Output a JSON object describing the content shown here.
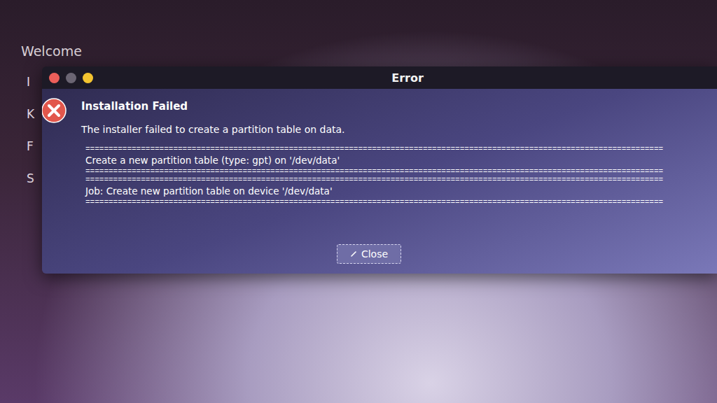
{
  "window": {
    "title": "Error"
  },
  "sidebar": {
    "title": "Welcome",
    "items": [
      "I",
      "K",
      "F",
      "S"
    ]
  },
  "dialog": {
    "heading": "Installation Failed",
    "message": "The installer failed to create a partition table on data.",
    "details": [
      {
        "kind": "separator",
        "text": "============================================================================================================================="
      },
      {
        "kind": "line",
        "text": "Create a new partition table (type: gpt) on '/dev/data'"
      },
      {
        "kind": "separator",
        "text": "============================================================================================================================="
      },
      {
        "kind": "separator",
        "text": "============================================================================================================================="
      },
      {
        "kind": "line",
        "text": "Job: Create new partition table on device '/dev/data'"
      },
      {
        "kind": "separator",
        "text": "============================================================================================================================="
      }
    ],
    "buttons": [
      "Close"
    ]
  }
}
